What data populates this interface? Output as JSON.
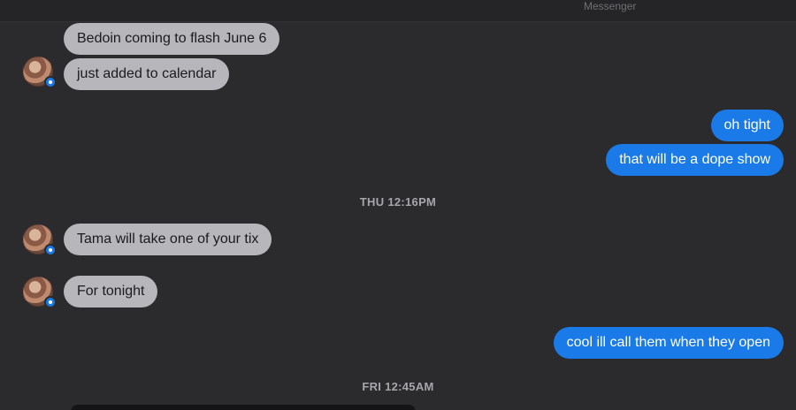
{
  "app": {
    "title": "Messenger"
  },
  "messages": [
    {
      "type": "incoming",
      "text": "Bedoin coming to flash June 6"
    },
    {
      "type": "incoming",
      "text": "just added to calendar"
    },
    {
      "type": "outgoing",
      "text": "oh tight"
    },
    {
      "type": "outgoing",
      "text": "that will be a dope show"
    },
    {
      "type": "timestamp",
      "text": "THU 12:16PM"
    },
    {
      "type": "incoming",
      "text": "Tama will take one of your tix"
    },
    {
      "type": "incoming",
      "text": "For tonight"
    },
    {
      "type": "outgoing",
      "text": "cool ill call them when they open"
    },
    {
      "type": "timestamp",
      "text": "FRI 12:45AM"
    }
  ],
  "colors": {
    "background": "#2b2b2d",
    "incoming_bubble": "#b7b7bb",
    "outgoing_bubble": "#1a7be8",
    "timestamp_text": "#a6a6ab",
    "title_text": "#6f6f74"
  },
  "icons": {
    "avatar": "contact-avatar",
    "badge": "messenger-badge-icon"
  }
}
